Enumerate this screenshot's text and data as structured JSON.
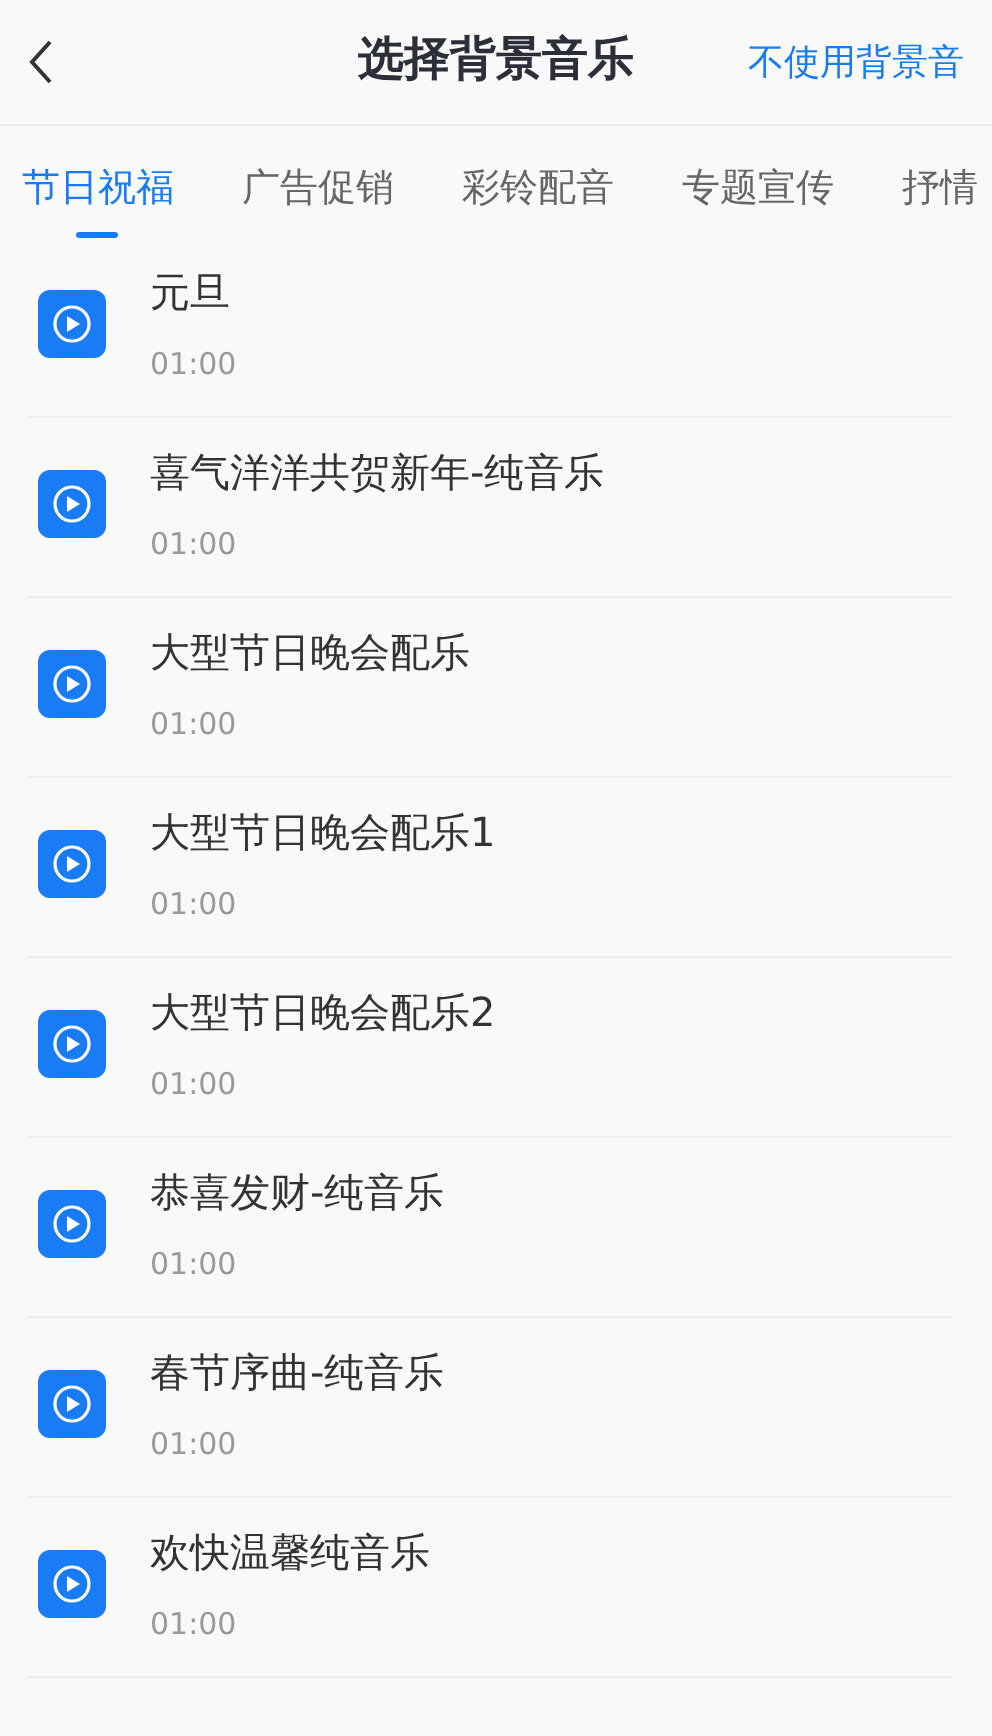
{
  "header": {
    "title": "选择背景音乐",
    "action": "不使用背景音"
  },
  "tabs": [
    {
      "label": "节日祝福",
      "selected": true
    },
    {
      "label": "广告促销",
      "selected": false
    },
    {
      "label": "彩铃配音",
      "selected": false
    },
    {
      "label": "专题宣传",
      "selected": false
    },
    {
      "label": "抒情",
      "selected": false
    }
  ],
  "tracks": [
    {
      "title": "元旦",
      "duration": "01:00"
    },
    {
      "title": "喜气洋洋共贺新年-纯音乐",
      "duration": "01:00"
    },
    {
      "title": "大型节日晚会配乐",
      "duration": "01:00"
    },
    {
      "title": "大型节日晚会配乐1",
      "duration": "01:00"
    },
    {
      "title": "大型节日晚会配乐2",
      "duration": "01:00"
    },
    {
      "title": "恭喜发财-纯音乐",
      "duration": "01:00"
    },
    {
      "title": "春节序曲-纯音乐",
      "duration": "01:00"
    },
    {
      "title": "欢快温馨纯音乐",
      "duration": "01:00"
    }
  ]
}
